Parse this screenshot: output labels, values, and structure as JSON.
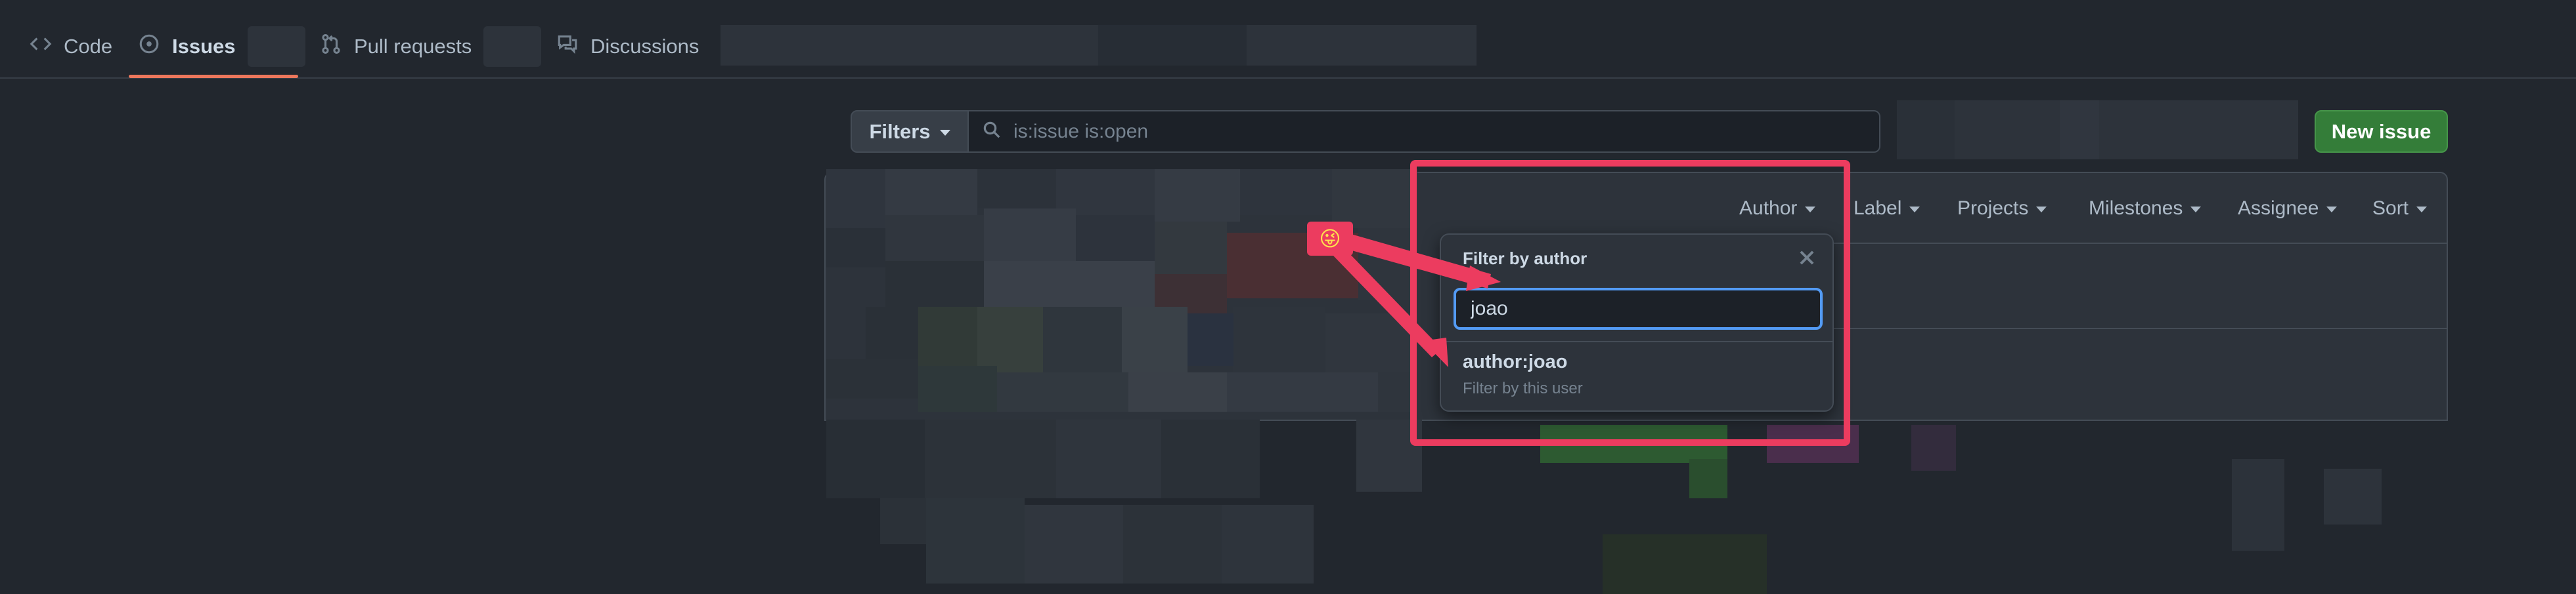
{
  "repo_nav": {
    "tabs": [
      {
        "label": "Code",
        "icon": "code-icon"
      },
      {
        "label": "Issues",
        "icon": "issue-opened-icon",
        "selected": true
      },
      {
        "label": "Pull requests",
        "icon": "git-pull-request-icon"
      },
      {
        "label": "Discussions",
        "icon": "comment-discussion-icon"
      }
    ]
  },
  "toolbar": {
    "filters_label": "Filters",
    "search_value": "is:issue is:open",
    "new_issue_label": "New issue"
  },
  "list_header": {
    "filters": [
      "Author",
      "Label",
      "Projects",
      "Milestones",
      "Assignee",
      "Sort"
    ]
  },
  "author_dropdown": {
    "title": "Filter by author",
    "input_value": "joao",
    "result_title": "author:joao",
    "result_description": "Filter by this user"
  },
  "annotation": {
    "emoji": "😜",
    "color": "#ec3c5f"
  },
  "colors": {
    "background": "#22272e",
    "accent_underline": "#ec775c",
    "primary_button": "#347d39",
    "focus_ring": "#539bf5"
  }
}
